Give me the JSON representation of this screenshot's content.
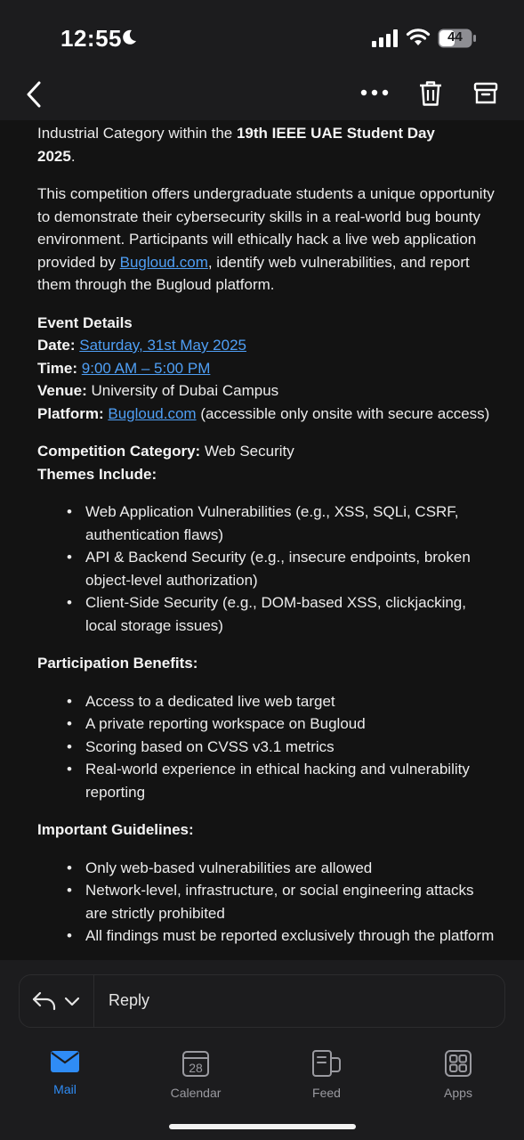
{
  "status": {
    "time": "12:55",
    "battery": "44"
  },
  "nav": {
    "back": "chevron-left-icon",
    "more": "more-icon",
    "delete": "trash-icon",
    "archive": "archive-icon"
  },
  "email": {
    "intro_prefix": "Industrial Category within the ",
    "intro_bold": "19th IEEE UAE Student Day",
    "intro_year": "2025",
    "intro_end": ".",
    "para_part1": "This competition offers undergraduate students a unique opportunity to demonstrate their cybersecurity skills in a real-world bug bounty environment. Participants will ethically hack a live web application provided by ",
    "para_link": "Bugloud.com",
    "para_part2": ", identify web vulnerabilities, and report them through the Bugloud platform.",
    "event_heading": "Event Details",
    "date_label": "Date:",
    "date_value": "Saturday, 31st May 2025",
    "time_label": "Time:",
    "time_value": "9:00 AM – 5:00 PM",
    "venue_label": "Venue:",
    "venue_value": " University of Dubai Campus",
    "platform_label": "Platform:",
    "platform_link": "Bugloud.com",
    "platform_rest": " (accessible only onsite with secure access)",
    "category_label": "Competition Category:",
    "category_value": " Web Security",
    "themes_heading": "Themes Include:",
    "themes": [
      "Web Application Vulnerabilities (e.g., XSS, SQLi, CSRF, authentication flaws)",
      "API & Backend Security (e.g., insecure endpoints, broken object-level authorization)",
      "Client-Side Security (e.g., DOM-based XSS, clickjacking, local storage issues)"
    ],
    "benefits_heading": "Participation Benefits:",
    "benefits": [
      "Access to a dedicated live web target",
      "A private reporting workspace on Bugloud",
      "Scoring based on CVSS v3.1 metrics",
      "Real-world experience in ethical hacking and vulnerability reporting"
    ],
    "guidelines_heading": "Important Guidelines:",
    "guidelines": [
      "Only web-based vulnerabilities are allowed",
      "Network-level, infrastructure, or social engineering attacks are strictly prohibited",
      "All findings must be reported exclusively through the platform"
    ]
  },
  "reply": {
    "label": "Reply"
  },
  "tabs": [
    {
      "label": "Mail",
      "icon": "mail-icon"
    },
    {
      "label": "Calendar",
      "icon": "calendar-icon",
      "day": "28"
    },
    {
      "label": "Feed",
      "icon": "feed-icon"
    },
    {
      "label": "Apps",
      "icon": "apps-icon"
    }
  ],
  "colors": {
    "accent": "#2f8cf5",
    "link": "#4f9ff5",
    "background": "#131313"
  }
}
